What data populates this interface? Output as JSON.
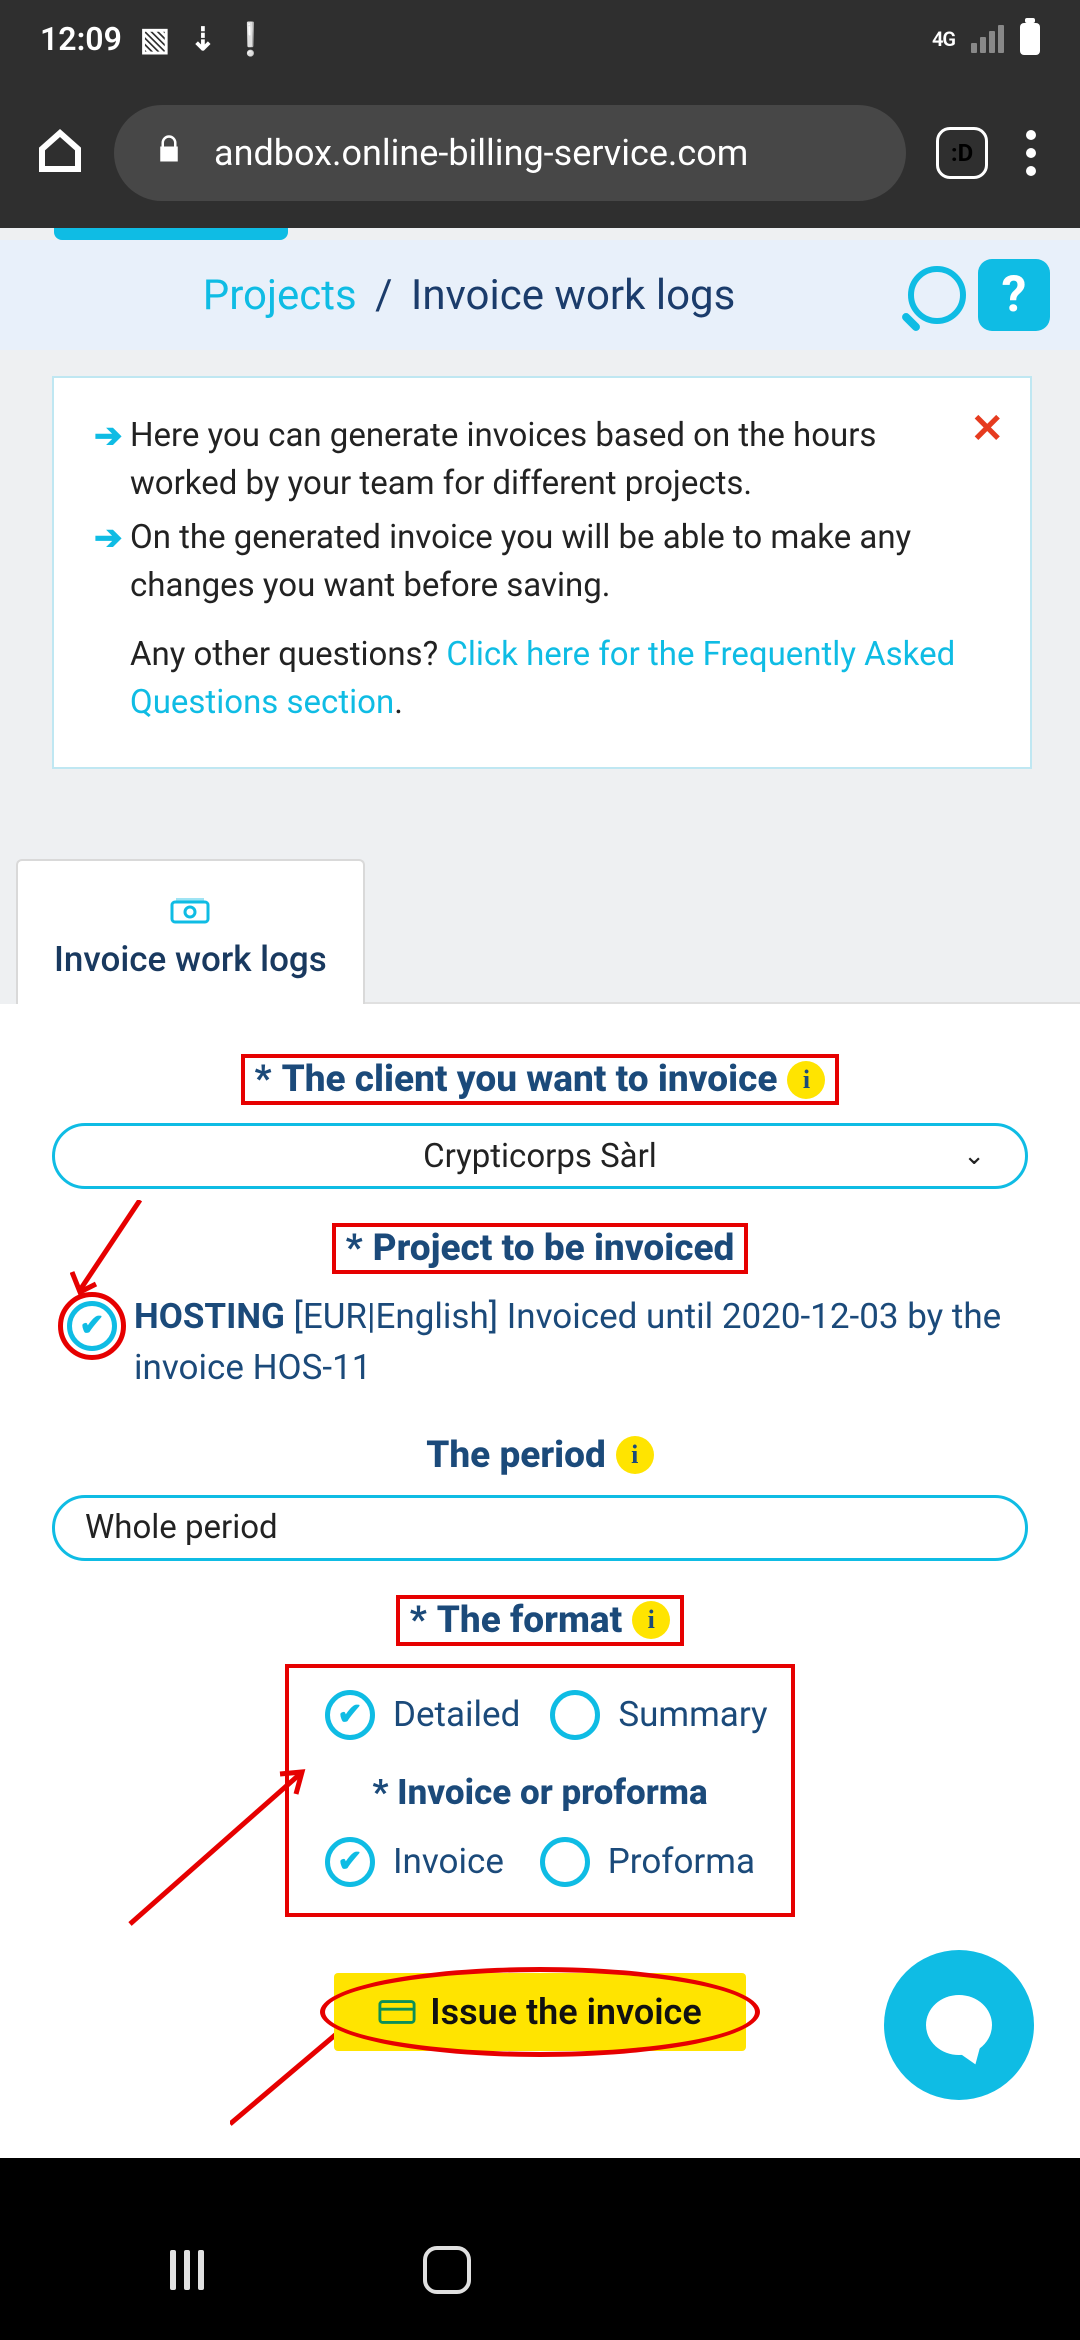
{
  "status": {
    "time": "12:09",
    "net": "4G"
  },
  "browser": {
    "url": "andbox.online-billing-service.com",
    "tab_badge": ":D"
  },
  "breadcrumb": {
    "link": "Projects",
    "sep": "/",
    "current": "Invoice work logs",
    "help": "?"
  },
  "info_box": {
    "line1": "Here you can generate invoices based on the hours worked by your team for different projects.",
    "line2": "On the generated invoice you will be able to make any changes you want before saving.",
    "faq_lead": "Any other questions? ",
    "faq_link": "Click here for the Frequently Asked Questions section",
    "faq_tail": "."
  },
  "tab": {
    "label": "Invoice work logs"
  },
  "form": {
    "client_label": "The client you want to invoice",
    "client_value": "Crypticorps Sàrl",
    "project_label": "Project to be invoiced",
    "project_row_name": "HOSTING",
    "project_row_rest": " [EUR|English] Invoiced until 2020-12-03 by the invoice HOS-11",
    "period_label": "The period",
    "period_value": "Whole period",
    "format_label": "The format",
    "opt_detailed": "Detailed",
    "opt_summary": "Summary",
    "doc_type_label": "Invoice or proforma",
    "opt_invoice": "Invoice",
    "opt_proforma": "Proforma",
    "submit": "Issue the invoice"
  }
}
